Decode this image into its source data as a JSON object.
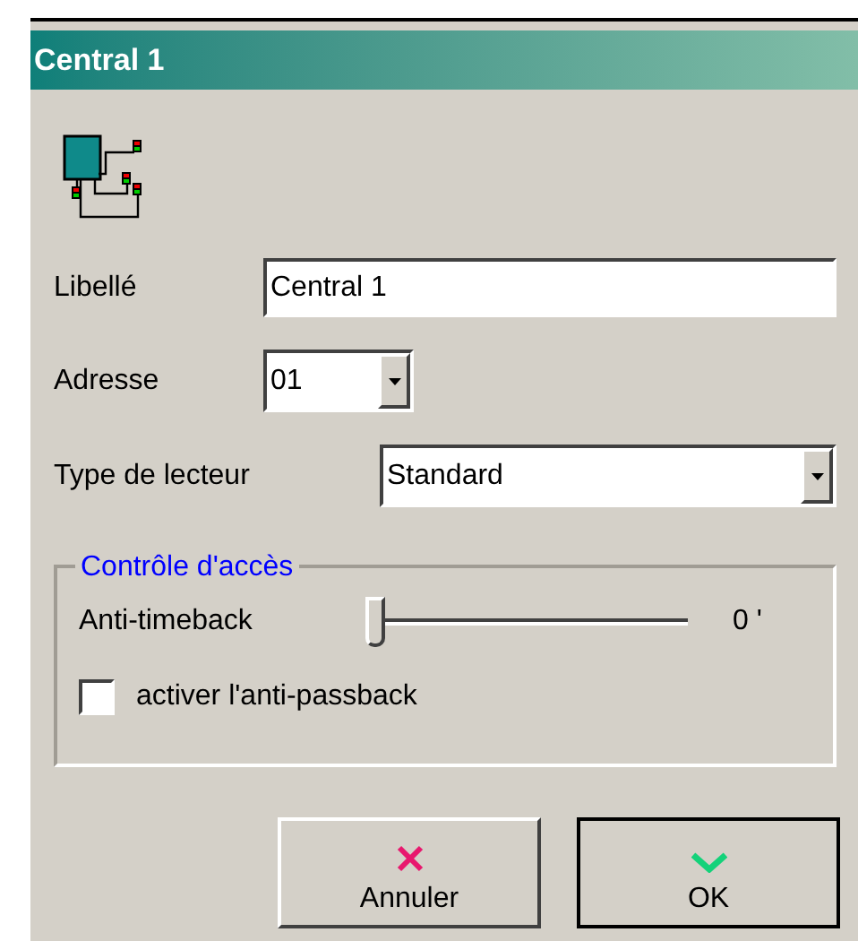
{
  "window": {
    "title": "Central 1"
  },
  "fields": [
    {
      "label": "Libellé",
      "kind": "text",
      "value": "Central 1"
    },
    {
      "label": "Adresse",
      "kind": "combo",
      "value": "01"
    },
    {
      "label": "Type de lecteur",
      "kind": "combo",
      "value": "Standard"
    }
  ],
  "access_control": {
    "title": "Contrôle d'accès",
    "slider": {
      "label": "Anti-timeback",
      "level": 0,
      "reading": "0 '"
    },
    "checkbox": {
      "label": "activer l'anti-passback",
      "checked": false
    }
  },
  "buttons": [
    {
      "kind": "cancel",
      "label": "Annuler"
    },
    {
      "kind": "ok",
      "label": "OK"
    }
  ]
}
